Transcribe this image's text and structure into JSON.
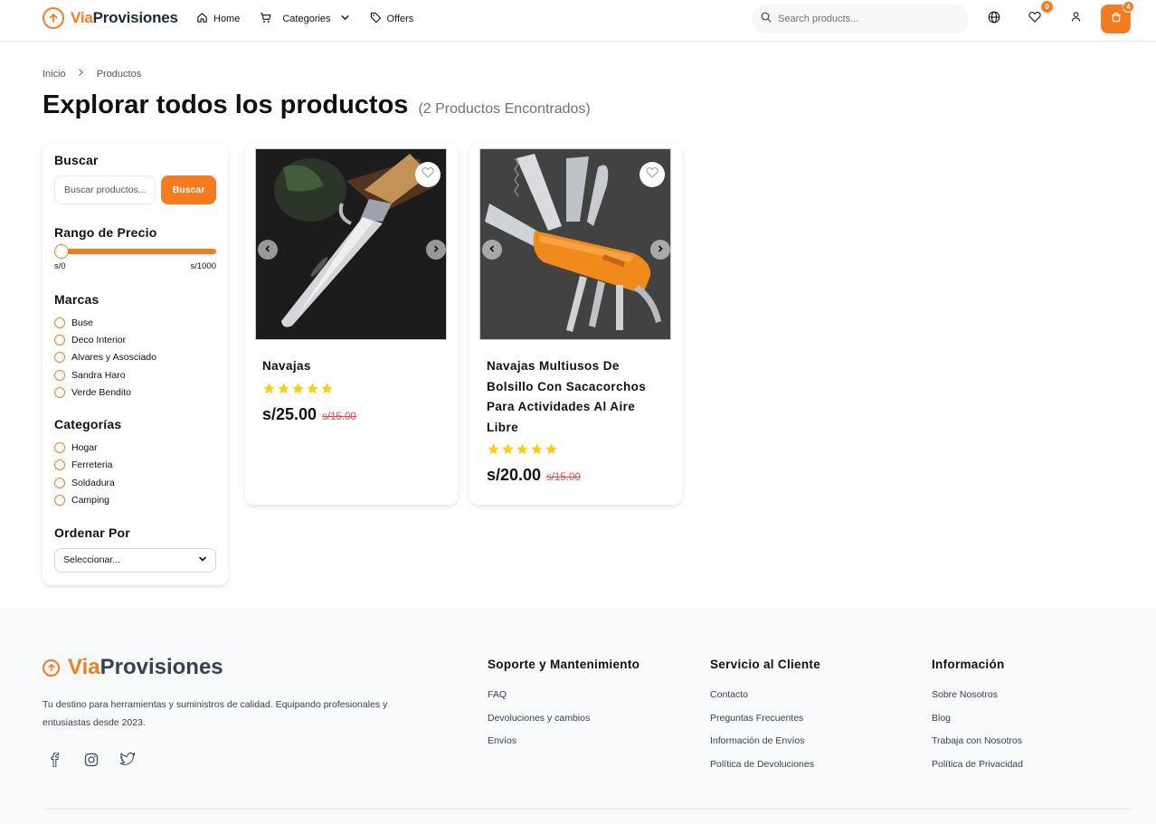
{
  "brand": {
    "first": "Via",
    "second": "Provisiones"
  },
  "nav": {
    "home": "Home",
    "categories": "Categories",
    "offers": "Offers"
  },
  "search": {
    "placeholder": "Search products..."
  },
  "header": {
    "wishlist_count": "0",
    "cart_count": "4"
  },
  "breadcrumb": {
    "home": "Inicio",
    "current": "Productos"
  },
  "page": {
    "title": "Explorar todos los productos",
    "count": "(2 Productos Encontrados)"
  },
  "sidebar": {
    "search_heading": "Buscar",
    "search_placeholder": "Buscar productos...",
    "search_button": "Buscar",
    "price_heading": "Rango de Precio",
    "price_min": "s/0",
    "price_max": "s/1000",
    "brands_heading": "Marcas",
    "brands": [
      "Buse",
      "Deco Interior",
      "Alvares y Asosciado",
      "Sandra Haro",
      "Verde Bendito"
    ],
    "categories_heading": "Categorías",
    "categories": [
      "Hogar",
      "Ferreteria",
      "Soldadura",
      "Camping"
    ],
    "sort_heading": "Ordenar Por",
    "sort_value": "Seleccionar..."
  },
  "products": [
    {
      "name": "Navajas",
      "rating": 5,
      "price": "s/25.00",
      "old_price": "s/15.00"
    },
    {
      "name": "Navajas Multiusos De Bolsillo Con Sacacorchos Para Actividades Al Aire Libre",
      "rating": 5,
      "price": "s/20.00",
      "old_price": "s/15.00"
    }
  ],
  "footer": {
    "description": "Tu destino para herramientas y suministros de calidad. Equipando profesionales y entusiastas desde 2023.",
    "social": [
      "facebook-icon",
      "instagram-icon",
      "twitter-icon"
    ],
    "columns": [
      {
        "title": "Soporte y Mantenimiento",
        "links": [
          "FAQ",
          "Devoluciones y cambios",
          "Envíos"
        ]
      },
      {
        "title": "Servicio al Cliente",
        "links": [
          "Contacto",
          "Preguntas Frecuentes",
          "Información de Envíos",
          "Política de Devoluciones"
        ]
      },
      {
        "title": "Información",
        "links": [
          "Sobre Nosotros",
          "Blog",
          "Trabaja con Nosotros",
          "Política de Privacidad"
        ]
      }
    ]
  },
  "colors": {
    "accent": "#f47b20",
    "star": "#facc15",
    "old_price": "#ef4444",
    "footer_bg": "#f8f9fa"
  }
}
